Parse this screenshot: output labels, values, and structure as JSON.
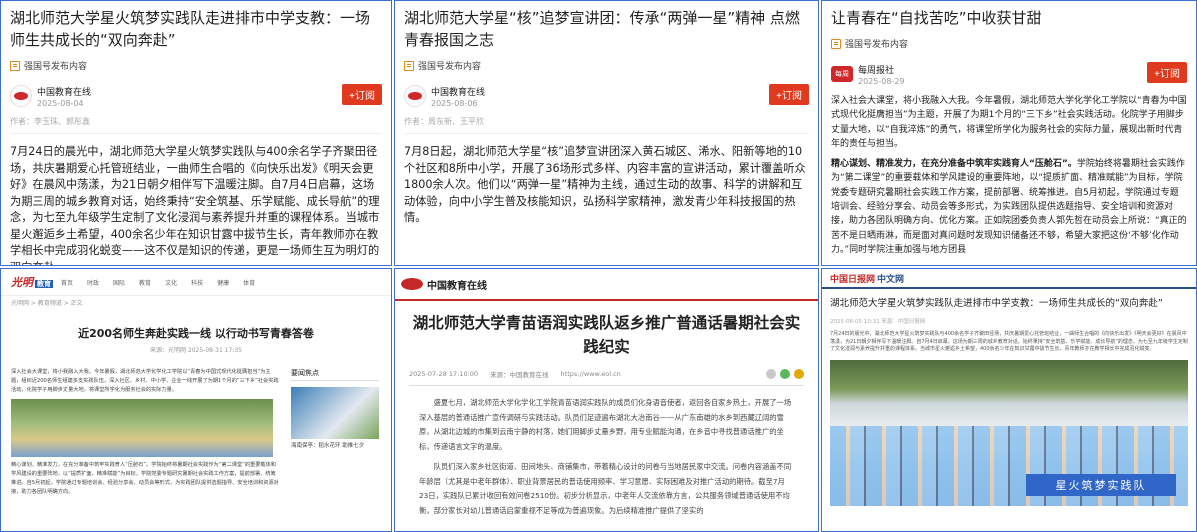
{
  "panels": {
    "p1": {
      "title": "湖北师范大学星火筑梦实践队走进排市中学支教：一场师生共成长的“双向奔赴”",
      "source": "强国号发布内容",
      "author": "中国教育在线",
      "date": "2025-08-04",
      "subscribe": "+订阅",
      "editor": "作者：李玉珠、郭彤鑫",
      "body": "7月24日的晨光中，湖北师范大学星火筑梦实践队与400余名学子齐聚田径场，共庆暑期爱心托管班结业，一曲师生合唱的《向快乐出发》《明天会更好》在晨风中荡漾，为21日朝夕相伴写下温暖注脚。自7月4日启幕，这场为期三周的城乡教育对话，始终秉持“安全筑基、乐学赋能、成长导航”的理念，为七至九年级学生定制了文化浸润与素养提升并重的课程体系。当城市星火邂逅乡土希望，400余名少年在知识甘露中拔节生长，青年教师亦在教学相长中完成羽化蜕变——这不仅是知识的传递，更是一场师生互为明灯的双向奔赴。"
    },
    "p2": {
      "title": "湖北师范大学星“核”追梦宣讲团：传承“两弹一星”精神 点燃青春报国之志",
      "source": "强国号发布内容",
      "author": "中国教育在线",
      "date": "2025-08-06",
      "subscribe": "+订阅",
      "editor": "作者：周东新、王平欣",
      "body": "7月8日起，湖北师范大学星“核”追梦宣讲团深入黄石城区、浠水、阳新等地的10个社区和8所中小学，开展了36场形式多样、内容丰富的宣讲活动，累计覆盖听众1800余人次。他们以“两弹一星”精神为主线，通过生动的故事、科学的讲解和互动体验，向中小学生普及核能知识，弘扬科学家精神，激发青少年科技报国的热情。"
    },
    "p3": {
      "title": "让青春在“自找苦吃”中收获甘甜",
      "source": "强国号发布内容",
      "author": "每周报社",
      "author_badge": "每周",
      "date": "2025-08-29",
      "subscribe": "+订阅",
      "body1": "深入社会大课堂，将小我融入大我。今年暑假，湖北师范大学化学化工学院以“青春为中国式现代化挺膺担当”为主题，开展了为期1个月的“三下乡”社会实践活动。化院学子用脚步丈量大地，以“自我淬炼”的勇气，将课堂所学化为服务社会的实际力量，展现出新时代青年的责任与担当。",
      "body2_bold": "精心谋划、精准发力，在充分准备中筑牢实践育人“压舱石”。",
      "body2": "学院始终将暑期社会实践作为“第二课堂”的重要载体和学风建设的重要阵地，以“提质扩面、精准赋能”为目标，学院党委专题研究暑期社会实践工作方案，提前部署、统筹推进。自5月初起，学院通过专题培训会、经验分享会、动员会等多形式，为实践团队提供选题指导、安全培训和资源对接，助力各团队明确方向、优化方案。正如院团委负责人郭先哲在动员会上所说：“真正的苦不是日晒雨淋，而是面对真问题时发现知识储备还不够，希望大家把这份‘不够’化作动力。”同时学院注重加强与地方团县"
    },
    "p4": {
      "logo": "光明",
      "logo_tag": "教育",
      "nav": [
        "首页",
        "时政",
        "国际",
        "教育",
        "文化",
        "科技",
        "健康",
        "体育"
      ],
      "crumb": "光明网 > 教育频道 > 正文",
      "title": "近200名师生奔赴实践一线 以行动书写青春答卷",
      "meta": "来源：光明网  2025-08-31 17:35",
      "text1": "深入社会大课堂，将小我融入大我。今年暑假，湖北师范大学化学化工学院以“青春为中国式现代化挺膺担当”为主题，组织近200名师生组建多支实践队伍，深入社区、乡村、中小学、企业一线开展了为期1个月的“三下乡”社会实践活动，化院学子用脚步丈量大地，将课堂所学化为服务社会的实际力量。",
      "text2": "精心谋划、精准发力，在充分准备中筑牢实践育人“压舱石”。学院始终将暑期社会实践作为“第二课堂”的重要载体和学风建设的重要阵地，以“提质扩面、精准赋能”为目标，学院党委专题研究暑期社会实践工作方案，提前部署、统筹推进。自5月初起，学院通过专题培训会、经验分享会、动员会等形式，为实践团队提供选题指导、安全培训和资源对接，助力各团队明确方向。",
      "side_title": "要闻焦点",
      "side_caption": "海南保亭：稻水花环 助推七夕"
    },
    "p5": {
      "logo": "中国教育在线",
      "title": "湖北师范大学青苗语润实践队返乡推广普通话暑期社会实践纪实",
      "date": "2025-07-28 17:10:00",
      "source": "来源：中国教育在线",
      "url": "https://www.eol.cn",
      "para1": "盛夏七月，湖北师范大学化学化工学院青苗语润实践队的成员们化身语音使者，返回各自家乡热土，开展了一场深入基层的普通话推广宣传调研与实践活动。队员们足迹遍布湖北大冶南谷——从广东南雄的水乡到西藏辽阔的雪原，从湖北边城的市集到云南宁静的村落，她们用脚步丈量乡野，用专业赋能沟通，在乡音中寻找普通话推广的坐标，传递语言文字的温度。",
      "para2": "队员们深入家乡社区街道、田间地头、商铺集市，带着精心设计的问卷与当地居民家中交流。问卷内容涵盖不同年龄层（尤其是中老年群体）、职业背景居民的普话使用频率、学习意愿、实际困难及对推广活动的期待。截至7月23日，实践队已累计收回有效问卷2510份。初步分析显示，中老年人交流依靠方言，公共服务领域普通话使用不均衡，部分家长对幼儿普通话启蒙重视不足等成为普遍现象。为后续精准推广提供了坚实的"
    },
    "p6": {
      "logo": "中国日报网",
      "logo_tag": "中文网",
      "title": "湖北师范大学星火筑梦实践队走进排市中学支教：一场师生共成长的“双向奔赴”",
      "meta": "2025-08-05 10:31    来源：中国日报网",
      "text": "7月24日的晨光中，湖北师范大学星火筑梦实践队与400余名学子齐聚田径场，共庆暑期爱心托管班结业，一曲师生合唱的《向快乐出发》《明天会更好》在晨风中荡漾，为21日朝夕相伴写下温暖注脚。自7月4日启幕，这场为期三周的城乡教育对话，始终秉持“安全筑基、乐学赋能、成长导航”的理念，为七至九年级学生定制了文化浸润与素养提升并重的课程体系。当城市星火邂逅乡土希望，400余名少年在知识甘露中拔节生长，青年教师亦在教学相长中完成羽化蜕变。",
      "banner": "星火筑梦实践队"
    }
  },
  "colors": {
    "frame": "#3b6fd4",
    "subscribe": "#e03a1e",
    "brand_red": "#c62828"
  }
}
